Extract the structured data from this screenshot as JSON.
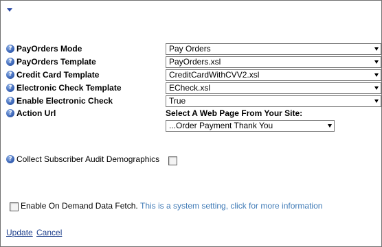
{
  "rows": [
    {
      "label": "PayOrders Mode",
      "value": "Pay Orders"
    },
    {
      "label": "PayOrders Template",
      "value": "PayOrders.xsl"
    },
    {
      "label": "Credit Card Template",
      "value": "CreditCardWithCVV2.xsl"
    },
    {
      "label": "Electronic Check Template",
      "value": "ECheck.xsl"
    },
    {
      "label": "Enable Electronic Check",
      "value": "True"
    }
  ],
  "action_url": {
    "label": "Action Url",
    "caption": "Select A Web Page From Your Site:",
    "value": "...Order Payment Thank You"
  },
  "collect_demographics": {
    "label": "Collect Subscriber Audit Demographics",
    "checked": false
  },
  "on_demand": {
    "label": "Enable On Demand Data Fetch.",
    "info": "This is a system setting, click for more information",
    "checked": false
  },
  "buttons": {
    "update": "Update",
    "cancel": "Cancel"
  },
  "colors": {
    "link": "#1d3f8c",
    "info_link": "#3f7ab6",
    "help_icon": "#3c66b8"
  },
  "icons": [
    "collapse-arrow-icon",
    "help-icon",
    "dropdown-arrow-icon",
    "checkbox"
  ]
}
